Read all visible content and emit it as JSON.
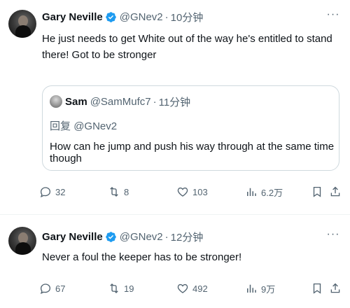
{
  "tweets": [
    {
      "name": "Gary Neville",
      "handle": "@GNev2",
      "separator": "·",
      "time": "10分钟",
      "text": "He just needs to get White out of the way he's entitled to stand there! Got to be stronger",
      "quote": {
        "name": "Sam",
        "handle": "@SamMufc7",
        "separator": "·",
        "time": "11分钟",
        "reply_prefix": "回复",
        "reply_to": "@GNev2",
        "text": "How can he jump and push his way through at the same time though"
      },
      "stats": {
        "replies": "32",
        "retweets": "8",
        "likes": "103",
        "views": "6.2万"
      }
    },
    {
      "name": "Gary Neville",
      "handle": "@GNev2",
      "separator": "·",
      "time": "12分钟",
      "text": "Never a foul the keeper has to be stronger!",
      "stats": {
        "replies": "67",
        "retweets": "19",
        "likes": "492",
        "views": "9万"
      }
    }
  ],
  "icons": {
    "verified": "verified-badge-icon",
    "more": "more-icon",
    "reply": "reply-icon",
    "retweet": "retweet-icon",
    "like": "heart-icon",
    "views": "views-icon",
    "bookmark": "bookmark-icon",
    "share": "share-icon"
  },
  "colors": {
    "accent": "#1d9bf0",
    "muted": "#536471",
    "text": "#0f1419",
    "border": "#cfd9de"
  }
}
